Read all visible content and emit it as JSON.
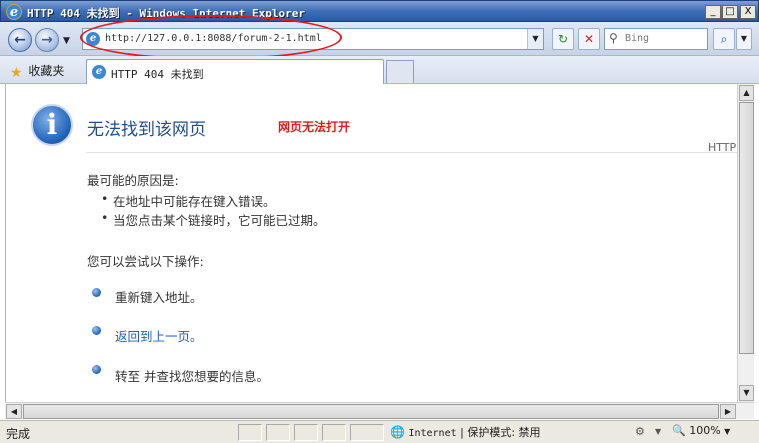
{
  "window": {
    "title": "HTTP 404 未找到 - Windows Internet Explorer",
    "minimize": "_",
    "maximize": "□",
    "close": "X"
  },
  "nav": {
    "back": "←",
    "forward": "→",
    "address": "http://127.0.0.1:8088/forum-2-1.html",
    "search_placeholder": "Bing",
    "refresh": "↻",
    "stop": "✕",
    "search_go": "⌕"
  },
  "tabs": {
    "favorites_label": "收藏夹",
    "active_tab": "HTTP 404 未找到"
  },
  "page": {
    "title": "无法找到该网页",
    "annotation": "网页无法打开",
    "http_label": "HTTP",
    "causes_title": "最可能的原因是:",
    "causes": [
      "在地址中可能存在键入错误。",
      "当您点击某个链接时，它可能已过期。"
    ],
    "try_title": "您可以尝试以下操作:",
    "options": [
      "重新键入地址。",
      "返回到上一页。",
      "转至  并查找您想要的信息。"
    ]
  },
  "status": {
    "text": "完成",
    "zone": "Internet",
    "protected_mode": "保护模式: 禁用",
    "zoom": "100%"
  },
  "colors": {
    "annotation_red": "#e01b1b",
    "title_blue": "#1f4e8c",
    "link_blue": "#1f5fb5"
  }
}
